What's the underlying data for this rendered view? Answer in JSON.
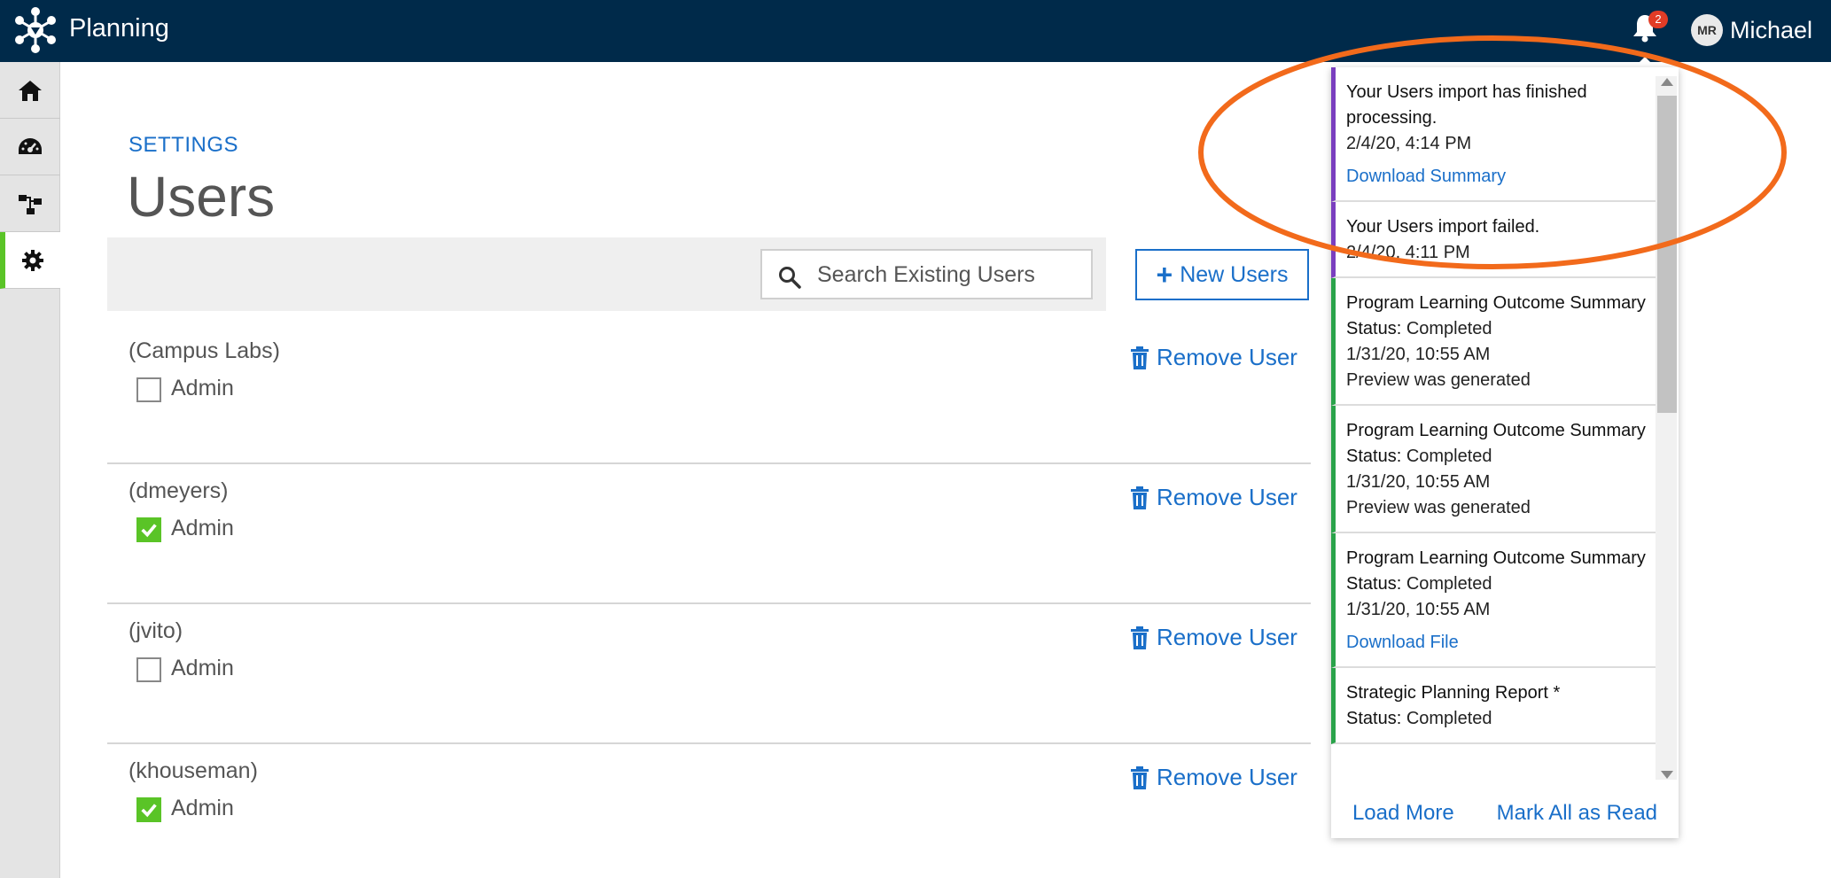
{
  "header": {
    "app_title": "Planning",
    "notification_count": "2",
    "avatar_initials": "MR",
    "user_name": "Michael"
  },
  "sidebar": {
    "items": [
      {
        "icon": "home-icon"
      },
      {
        "icon": "dashboard-icon"
      },
      {
        "icon": "hierarchy-icon"
      },
      {
        "icon": "gear-icon",
        "active": true
      }
    ]
  },
  "main": {
    "breadcrumb": "SETTINGS",
    "title": "Users",
    "search_placeholder": "Search Existing Users",
    "new_users_label": "New Users",
    "users": [
      {
        "name": "(Campus Labs)",
        "admin_label": "Admin",
        "admin": false,
        "remove_label": "Remove User"
      },
      {
        "name": "(dmeyers)",
        "admin_label": "Admin",
        "admin": true,
        "remove_label": "Remove User"
      },
      {
        "name": "(jvito)",
        "admin_label": "Admin",
        "admin": false,
        "remove_label": "Remove User"
      },
      {
        "name": "(khouseman)",
        "admin_label": "Admin",
        "admin": true,
        "remove_label": "Remove User"
      }
    ]
  },
  "notifications": {
    "items": [
      {
        "title": "Your Users import has finished processing.",
        "time": "2/4/20, 4:14 PM",
        "link": "Download Summary"
      },
      {
        "title": "Your Users import failed.",
        "time": "2/4/20, 4:11 PM"
      },
      {
        "title": "Program Learning Outcome Summary",
        "status_label": "Status:",
        "status": "Completed",
        "time": "1/31/20, 10:55 AM",
        "note": "Preview was generated"
      },
      {
        "title": "Program Learning Outcome Summary",
        "status_label": "Status:",
        "status": "Completed",
        "time": "1/31/20, 10:55 AM",
        "note": "Preview was generated"
      },
      {
        "title": "Program Learning Outcome Summary",
        "status_label": "Status:",
        "status": "Completed",
        "time": "1/31/20, 10:55 AM",
        "link": "Download File"
      },
      {
        "title": "Strategic Planning Report *",
        "status_label": "Status:",
        "status": "Completed"
      }
    ],
    "load_more_label": "Load More",
    "mark_all_label": "Mark All as Read"
  },
  "colors": {
    "header_bg": "#002a4a",
    "accent_blue": "#1a6fc9",
    "active_green": "#5ac427",
    "annotation_orange": "#f26a1b"
  }
}
